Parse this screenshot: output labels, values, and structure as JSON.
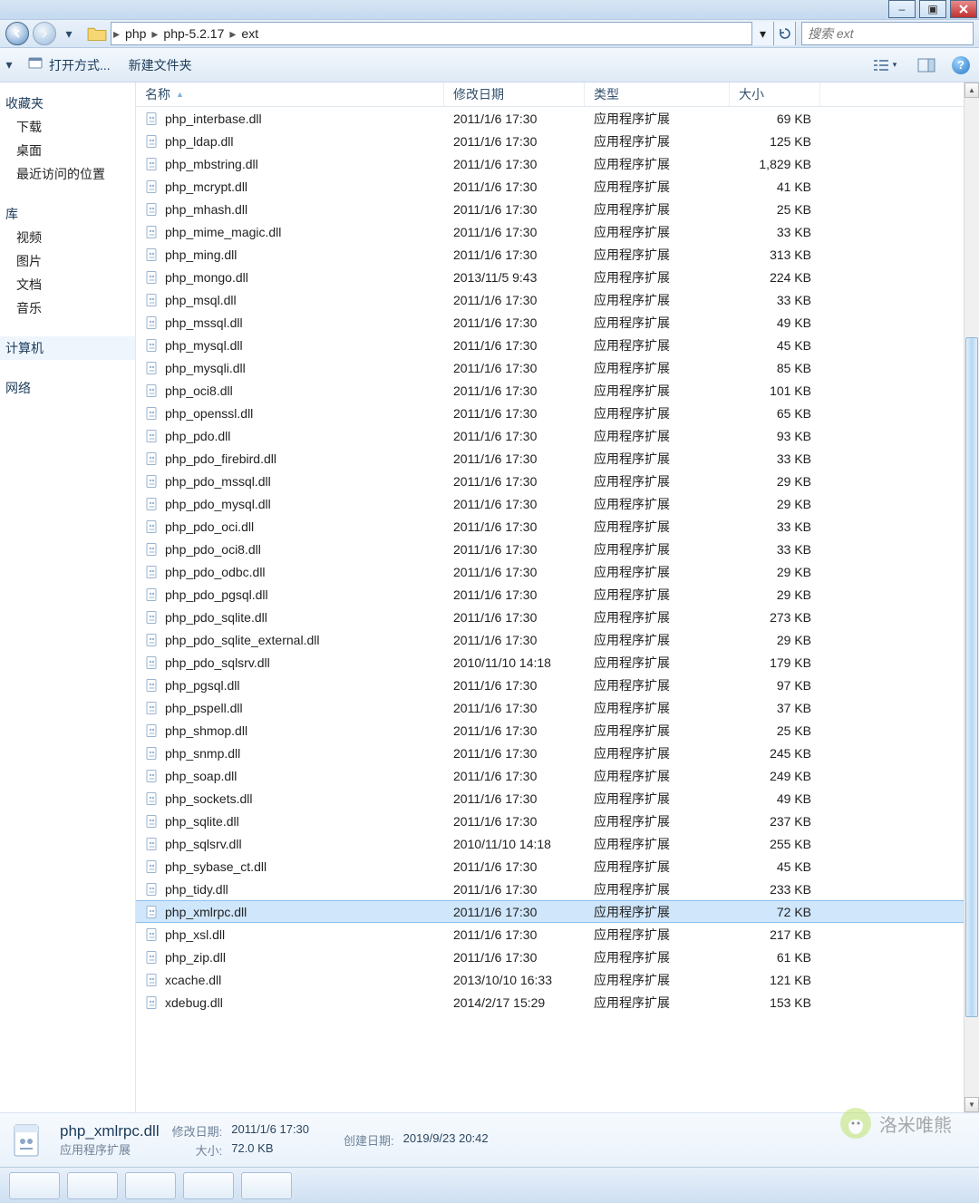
{
  "window": {
    "min": "–",
    "max": "▣",
    "close": "✕"
  },
  "breadcrumb": {
    "parts": [
      "php",
      "php-5.2.17",
      "ext"
    ]
  },
  "search": {
    "placeholder": "搜索 ext"
  },
  "toolbar": {
    "open_with": "打开方式...",
    "new_folder": "新建文件夹"
  },
  "sidebar": {
    "favorites": {
      "title": "收藏夹",
      "items": [
        "下载",
        "桌面",
        "最近访问的位置"
      ]
    },
    "libraries": {
      "title": "库",
      "items": [
        "视频",
        "图片",
        "文档",
        "音乐"
      ]
    },
    "computer": {
      "title": "计算机"
    },
    "network": {
      "title": "网络"
    }
  },
  "columns": {
    "name": "名称",
    "date": "修改日期",
    "type": "类型",
    "size": "大小"
  },
  "file_type_label": "应用程序扩展",
  "files": [
    {
      "name": "php_interbase.dll",
      "date": "2011/1/6 17:30",
      "size": "69 KB"
    },
    {
      "name": "php_ldap.dll",
      "date": "2011/1/6 17:30",
      "size": "125 KB"
    },
    {
      "name": "php_mbstring.dll",
      "date": "2011/1/6 17:30",
      "size": "1,829 KB"
    },
    {
      "name": "php_mcrypt.dll",
      "date": "2011/1/6 17:30",
      "size": "41 KB"
    },
    {
      "name": "php_mhash.dll",
      "date": "2011/1/6 17:30",
      "size": "25 KB"
    },
    {
      "name": "php_mime_magic.dll",
      "date": "2011/1/6 17:30",
      "size": "33 KB"
    },
    {
      "name": "php_ming.dll",
      "date": "2011/1/6 17:30",
      "size": "313 KB"
    },
    {
      "name": "php_mongo.dll",
      "date": "2013/11/5 9:43",
      "size": "224 KB"
    },
    {
      "name": "php_msql.dll",
      "date": "2011/1/6 17:30",
      "size": "33 KB"
    },
    {
      "name": "php_mssql.dll",
      "date": "2011/1/6 17:30",
      "size": "49 KB"
    },
    {
      "name": "php_mysql.dll",
      "date": "2011/1/6 17:30",
      "size": "45 KB"
    },
    {
      "name": "php_mysqli.dll",
      "date": "2011/1/6 17:30",
      "size": "85 KB"
    },
    {
      "name": "php_oci8.dll",
      "date": "2011/1/6 17:30",
      "size": "101 KB"
    },
    {
      "name": "php_openssl.dll",
      "date": "2011/1/6 17:30",
      "size": "65 KB"
    },
    {
      "name": "php_pdo.dll",
      "date": "2011/1/6 17:30",
      "size": "93 KB"
    },
    {
      "name": "php_pdo_firebird.dll",
      "date": "2011/1/6 17:30",
      "size": "33 KB"
    },
    {
      "name": "php_pdo_mssql.dll",
      "date": "2011/1/6 17:30",
      "size": "29 KB"
    },
    {
      "name": "php_pdo_mysql.dll",
      "date": "2011/1/6 17:30",
      "size": "29 KB"
    },
    {
      "name": "php_pdo_oci.dll",
      "date": "2011/1/6 17:30",
      "size": "33 KB"
    },
    {
      "name": "php_pdo_oci8.dll",
      "date": "2011/1/6 17:30",
      "size": "33 KB"
    },
    {
      "name": "php_pdo_odbc.dll",
      "date": "2011/1/6 17:30",
      "size": "29 KB"
    },
    {
      "name": "php_pdo_pgsql.dll",
      "date": "2011/1/6 17:30",
      "size": "29 KB"
    },
    {
      "name": "php_pdo_sqlite.dll",
      "date": "2011/1/6 17:30",
      "size": "273 KB"
    },
    {
      "name": "php_pdo_sqlite_external.dll",
      "date": "2011/1/6 17:30",
      "size": "29 KB"
    },
    {
      "name": "php_pdo_sqlsrv.dll",
      "date": "2010/11/10 14:18",
      "size": "179 KB"
    },
    {
      "name": "php_pgsql.dll",
      "date": "2011/1/6 17:30",
      "size": "97 KB"
    },
    {
      "name": "php_pspell.dll",
      "date": "2011/1/6 17:30",
      "size": "37 KB"
    },
    {
      "name": "php_shmop.dll",
      "date": "2011/1/6 17:30",
      "size": "25 KB"
    },
    {
      "name": "php_snmp.dll",
      "date": "2011/1/6 17:30",
      "size": "245 KB"
    },
    {
      "name": "php_soap.dll",
      "date": "2011/1/6 17:30",
      "size": "249 KB"
    },
    {
      "name": "php_sockets.dll",
      "date": "2011/1/6 17:30",
      "size": "49 KB"
    },
    {
      "name": "php_sqlite.dll",
      "date": "2011/1/6 17:30",
      "size": "237 KB"
    },
    {
      "name": "php_sqlsrv.dll",
      "date": "2010/11/10 14:18",
      "size": "255 KB"
    },
    {
      "name": "php_sybase_ct.dll",
      "date": "2011/1/6 17:30",
      "size": "45 KB"
    },
    {
      "name": "php_tidy.dll",
      "date": "2011/1/6 17:30",
      "size": "233 KB"
    },
    {
      "name": "php_xmlrpc.dll",
      "date": "2011/1/6 17:30",
      "size": "72 KB",
      "selected": true
    },
    {
      "name": "php_xsl.dll",
      "date": "2011/1/6 17:30",
      "size": "217 KB"
    },
    {
      "name": "php_zip.dll",
      "date": "2011/1/6 17:30",
      "size": "61 KB"
    },
    {
      "name": "xcache.dll",
      "date": "2013/10/10 16:33",
      "size": "121 KB"
    },
    {
      "name": "xdebug.dll",
      "date": "2014/2/17 15:29",
      "size": "153 KB"
    }
  ],
  "details": {
    "name": "php_xmlrpc.dll",
    "type": "应用程序扩展",
    "labels": {
      "modified": "修改日期:",
      "created": "创建日期:",
      "size": "大小:"
    },
    "modified": "2011/1/6 17:30",
    "created": "2019/9/23 20:42",
    "size": "72.0 KB"
  },
  "watermark": {
    "text": "洛米唯熊"
  },
  "scrollbar": {
    "thumb_top_pct": 24,
    "thumb_height_pct": 68
  }
}
